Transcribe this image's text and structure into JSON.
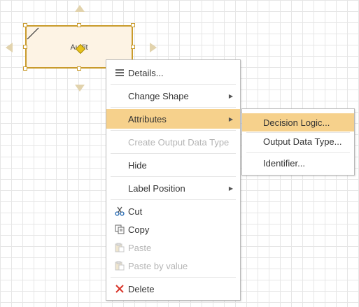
{
  "canvas": {
    "shape_label": "Audit"
  },
  "context_menu": {
    "items": [
      {
        "label": "Details...",
        "icon": "list-icon"
      },
      {
        "label": "Change Shape",
        "has_submenu": true
      },
      {
        "label": "Attributes",
        "has_submenu": true,
        "highlighted": true
      },
      {
        "label": "Create Output Data Type",
        "disabled": true
      },
      {
        "label": "Hide"
      },
      {
        "label": "Label Position",
        "has_submenu": true
      },
      {
        "label": "Cut",
        "icon": "scissors-icon"
      },
      {
        "label": "Copy",
        "icon": "copy-icon"
      },
      {
        "label": "Paste",
        "icon": "paste-icon",
        "disabled": true
      },
      {
        "label": "Paste by value",
        "icon": "paste-icon",
        "disabled": true
      },
      {
        "label": "Delete",
        "icon": "delete-x-icon"
      }
    ]
  },
  "attributes_submenu": {
    "items": [
      {
        "label": "Decision Logic...",
        "highlighted": true
      },
      {
        "label": "Output Data Type..."
      },
      {
        "label": "Identifier..."
      }
    ]
  },
  "colors": {
    "highlight": "#f6d18c",
    "shape_border": "#c99b2c",
    "shape_fill": "#fdf3e4",
    "handle_arrow": "#e2d3ad",
    "delete_red": "#d9362b",
    "scissors_blue": "#2d6fb5"
  }
}
